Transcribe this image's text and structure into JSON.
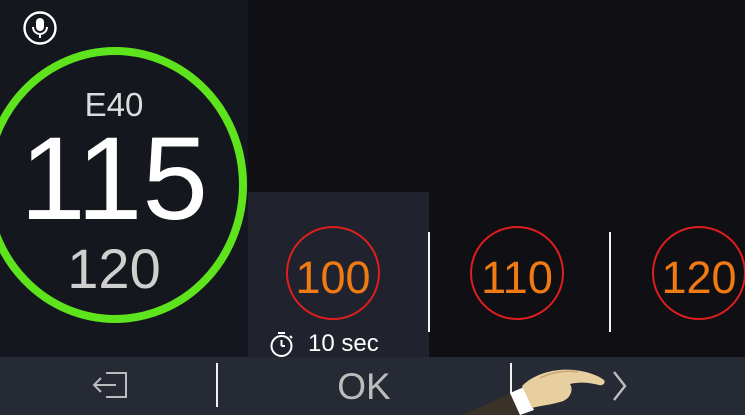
{
  "speedometer": {
    "road": "E40",
    "current_speed": "115",
    "speed_limit": "120",
    "ring_color": "#5ee41d"
  },
  "options": [
    {
      "value": "100",
      "selected": true
    },
    {
      "value": "110",
      "selected": false
    },
    {
      "value": "120",
      "selected": false
    }
  ],
  "timer": {
    "label": "10 sec"
  },
  "bottom_bar": {
    "exit_icon": "exit-icon",
    "ok_label": "OK",
    "next_icon": "chevron-right-icon"
  },
  "colors": {
    "sign_border": "#e01e1e",
    "sign_value": "#f07a14",
    "selected_bg": "#20232d"
  }
}
